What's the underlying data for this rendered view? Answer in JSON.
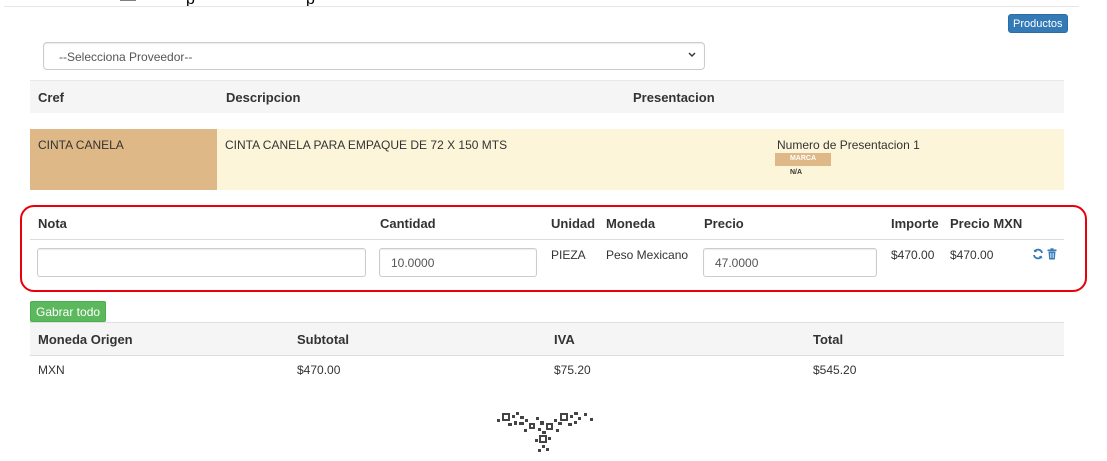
{
  "toolbar": {
    "productos_label": "Productos"
  },
  "proveedor_select": {
    "selected": "--Selecciona Proveedor--"
  },
  "product_table": {
    "headers": {
      "cref": "Cref",
      "descripcion": "Descripcion",
      "presentacion": "Presentacion"
    },
    "row": {
      "cref": "CINTA CANELA",
      "descripcion": "CINTA CANELA PARA EMPAQUE DE 72 X 150 MTS",
      "presentacion": "Numero de Presentacion 1",
      "marca_label": "MARCA",
      "marca_value": "N/A"
    }
  },
  "detail_table": {
    "headers": {
      "nota": "Nota",
      "cantidad": "Cantidad",
      "unidad": "Unidad",
      "moneda": "Moneda",
      "precio": "Precio",
      "importe": "Importe",
      "precio_mxn": "Precio MXN"
    },
    "row": {
      "nota": "",
      "cantidad": "10.0000",
      "unidad": "PIEZA",
      "moneda": "Peso Mexicano",
      "precio": "47.0000",
      "importe": "$470.00",
      "precio_mxn": "$470.00"
    }
  },
  "save_all_label": "Gabrar todo",
  "totals_table": {
    "headers": {
      "moneda_origen": "Moneda Origen",
      "subtotal": "Subtotal",
      "iva": "IVA",
      "total": "Total"
    },
    "row": {
      "moneda_origen": "MXN",
      "subtotal": "$470.00",
      "iva": "$75.20",
      "total": "$545.20"
    }
  },
  "icons": [
    "refresh-icon",
    "trash-icon",
    "chevron-down-icon",
    "qr-logo"
  ],
  "colors": {
    "primary": "#337ab7",
    "success": "#5cb85c",
    "cref_bg": "#deb887",
    "row_bg": "#fdf5d9",
    "highlight": "#e8000b"
  }
}
